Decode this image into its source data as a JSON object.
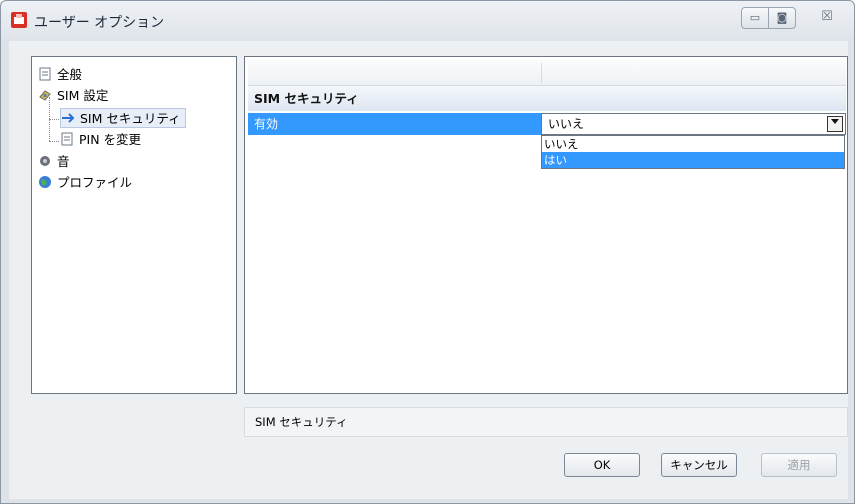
{
  "window": {
    "title": "ユーザー オプション",
    "controls": {
      "minimize": "▭",
      "maximize": "◙",
      "close": "☒"
    }
  },
  "tree": {
    "items": [
      {
        "label": "全般",
        "icon": "document-icon"
      },
      {
        "label": "SIM 設定",
        "icon": "sim-card-icon"
      },
      {
        "label": "SIM セキュリティ",
        "icon": "arrow-right-icon",
        "selected": true
      },
      {
        "label": "PIN を変更",
        "icon": "document-icon"
      },
      {
        "label": "音",
        "icon": "sound-icon"
      },
      {
        "label": "プロファイル",
        "icon": "profile-globe-icon"
      }
    ]
  },
  "panel": {
    "section_title": "SIM セキュリティ",
    "property": {
      "name": "有効",
      "value": "いいえ"
    },
    "dropdown": {
      "options": [
        "いいえ",
        "はい"
      ],
      "highlighted": "はい"
    }
  },
  "description": "SIM セキュリティ",
  "buttons": {
    "ok": "OK",
    "cancel": "キャンセル",
    "apply": "適用"
  },
  "colors": {
    "selection": "#3399ff",
    "section_header": "#dde6f1"
  }
}
